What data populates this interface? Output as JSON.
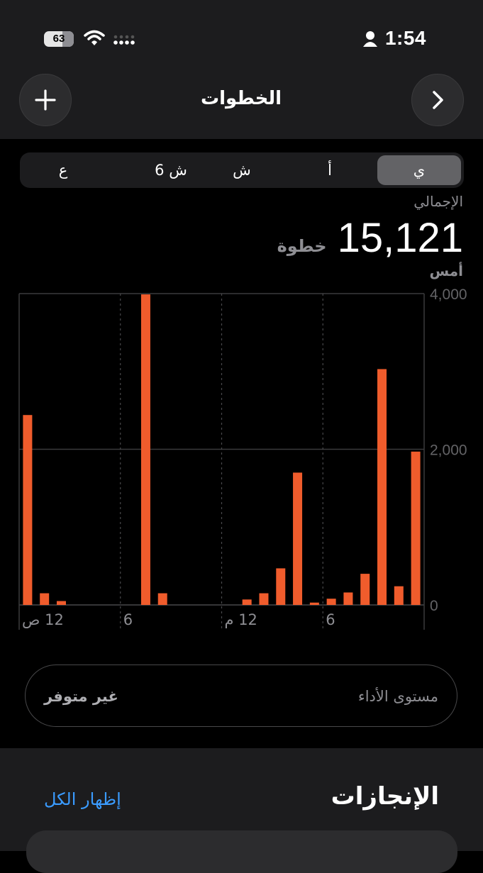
{
  "status_bar": {
    "battery": "63",
    "time": "1:54"
  },
  "header": {
    "title": "الخطوات",
    "add_icon": "plus-icon",
    "next_icon": "chevron-right-icon"
  },
  "segments": [
    "ي",
    "أ",
    "ش",
    "6 ش",
    "ع"
  ],
  "selected_segment": "ي",
  "summary": {
    "label": "الإجمالي",
    "value": "15,121",
    "unit": "خطوة",
    "date": "أمس"
  },
  "chart_data": {
    "type": "bar",
    "y_ticks": [
      "4,000",
      "2,000",
      "0"
    ],
    "ylim": [
      0,
      4000
    ],
    "x_ticks": [
      {
        "hour": 0,
        "label": "12 ص"
      },
      {
        "hour": 6,
        "label": "6"
      },
      {
        "hour": 12,
        "label": "12 م"
      },
      {
        "hour": 18,
        "label": "6"
      }
    ],
    "x": [
      0,
      1,
      2,
      3,
      4,
      5,
      6,
      7,
      8,
      9,
      10,
      11,
      12,
      13,
      14,
      15,
      16,
      17,
      18,
      19,
      20,
      21,
      22,
      23
    ],
    "values": [
      2440,
      150,
      50,
      0,
      0,
      0,
      0,
      3990,
      150,
      0,
      0,
      0,
      0,
      70,
      150,
      470,
      1700,
      30,
      80,
      160,
      400,
      3030,
      240,
      1970
    ],
    "color": "#f05c2c",
    "grid": true
  },
  "performance": {
    "label": "مستوى الأداء",
    "value": "غير متوفر"
  },
  "achievements": {
    "title": "الإنجازات",
    "show_all": "إظهار الكل"
  }
}
